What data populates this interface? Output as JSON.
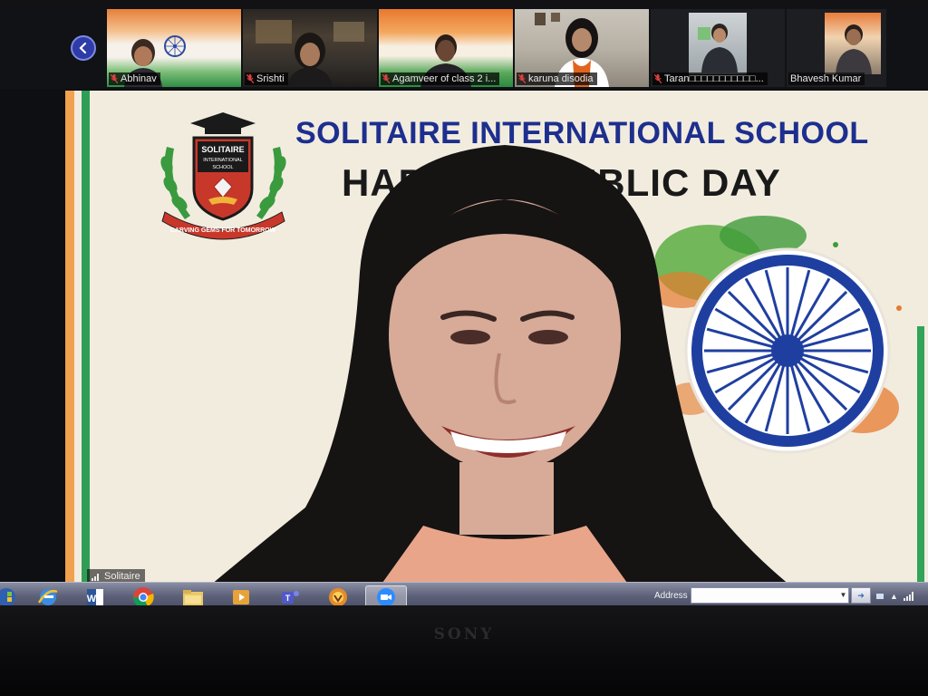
{
  "gallery": {
    "participants": [
      {
        "name": "Abhinav",
        "muted": true
      },
      {
        "name": "Srishti",
        "muted": true
      },
      {
        "name": "Agamveer of class 2 i...",
        "muted": true
      },
      {
        "name": "karuna disodia",
        "muted": true
      },
      {
        "name": "Taran□□□□□□□□□□□...",
        "muted": true
      },
      {
        "name": "Bhavesh Kumar",
        "muted": false
      }
    ]
  },
  "main": {
    "school_title": "SOLITAIRE INTERNATIONAL SCHOOL",
    "occasion": "HAPPY REPUBLIC DAY",
    "logo": {
      "name_line1": "SOLITAIRE",
      "name_line2": "INTERNATIONAL",
      "name_line3": "SCHOOL",
      "motto": "CARVING GEMS FOR TOMORROW"
    },
    "speaker_name": "Solitaire"
  },
  "taskbar": {
    "apps": [
      "windows-logo-icon",
      "internet-explorer-icon",
      "word-icon",
      "chrome-icon",
      "explorer-folder-icon",
      "media-player-icon",
      "teams-icon",
      "browser-icon",
      "zoom-icon"
    ],
    "address_label": "Address",
    "address_value": ""
  },
  "monitor_brand": "SONY",
  "colors": {
    "school_blue": "#1d2f8e",
    "saffron": "#f0a24e",
    "green": "#2f9d55",
    "chakra_blue": "#1f3fa0"
  }
}
